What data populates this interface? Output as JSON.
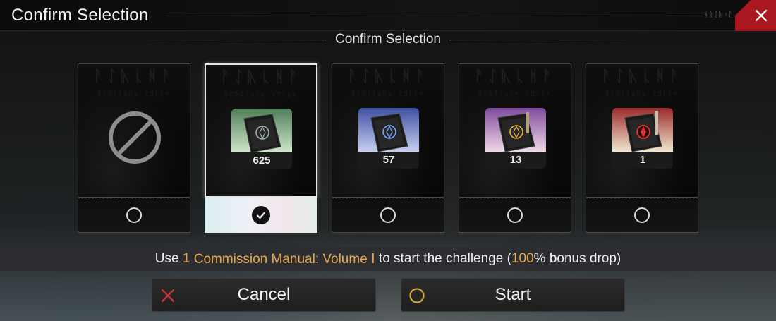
{
  "window": {
    "title": "Confirm Selection",
    "title_glyph": "ᚾᚱᛇᚣᚲᚢ"
  },
  "close_icon": "close-icon",
  "subtitle": "Confirm Selection",
  "card_rune": "ᚨᛇᚣᚳᚻᚨ",
  "card_rune_sub": "ᛒᚩᚢᛏᛁᛟᚢᛋ ᚷᛖᚪᚱᛋ",
  "cards": [
    {
      "kind": "none",
      "count": "",
      "selected": false,
      "icon": "prohibited-icon"
    },
    {
      "kind": "manual-green",
      "count": "625",
      "selected": true,
      "icon": "commission-manual-icon"
    },
    {
      "kind": "manual-blue",
      "count": "57",
      "selected": false,
      "icon": "commission-manual-icon"
    },
    {
      "kind": "manual-purple",
      "count": "13",
      "selected": false,
      "icon": "commission-manual-icon"
    },
    {
      "kind": "manual-red",
      "count": "1",
      "selected": false,
      "icon": "commission-manual-icon"
    }
  ],
  "info": {
    "prefix": "Use ",
    "qty": "1",
    "item": " Commission Manual: Volume Ⅰ",
    "mid": " to start the challenge (",
    "bonus": "100",
    "suffix": "% bonus drop)"
  },
  "buttons": {
    "cancel_label": "Cancel",
    "start_label": "Start"
  },
  "colors": {
    "accent": "#e7a94c",
    "close_bg": "#a8181e",
    "cancel_x": "#c8323a",
    "start_ring": "#d8a63c"
  }
}
